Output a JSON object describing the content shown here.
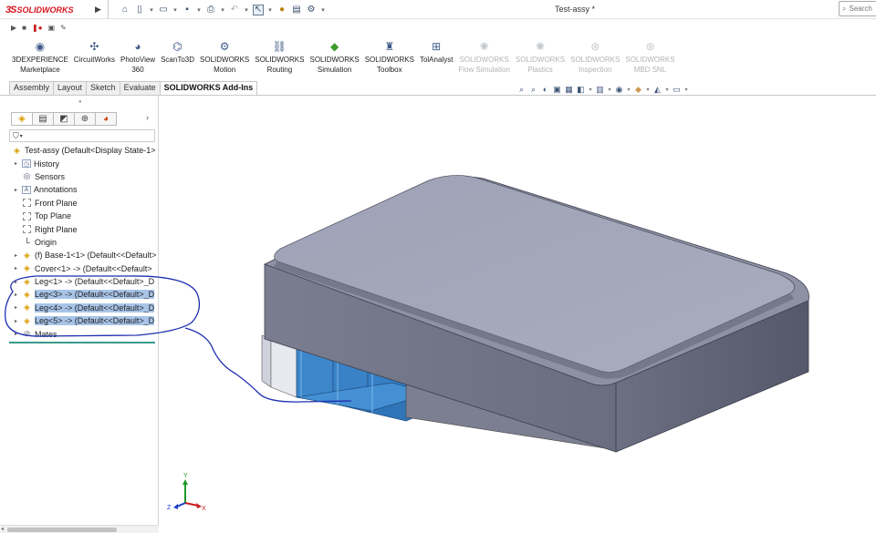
{
  "app": {
    "logo_ds": "3S",
    "logo_name": "SOLIDWORKS",
    "document_title": "Test-assy *",
    "search_placeholder": "Search"
  },
  "command_manager": [
    {
      "line1": "3DEXPERIENCE",
      "line2": "Marketplace",
      "icon": "globe-icon",
      "enabled": true
    },
    {
      "line1": "CircuitWorks",
      "line2": "",
      "icon": "circuit-icon",
      "enabled": true
    },
    {
      "line1": "PhotoView",
      "line2": "360",
      "icon": "sphere-icon",
      "enabled": true
    },
    {
      "line1": "ScanTo3D",
      "line2": "",
      "icon": "scan-icon",
      "enabled": true
    },
    {
      "line1": "SOLIDWORKS",
      "line2": "Motion",
      "icon": "motion-icon",
      "enabled": true
    },
    {
      "line1": "SOLIDWORKS",
      "line2": "Routing",
      "icon": "routing-icon",
      "enabled": true
    },
    {
      "line1": "SOLIDWORKS",
      "line2": "Simulation",
      "icon": "simulation-icon",
      "enabled": true
    },
    {
      "line1": "SOLIDWORKS",
      "line2": "Toolbox",
      "icon": "toolbox-icon",
      "enabled": true
    },
    {
      "line1": "TolAnalyst",
      "line2": "",
      "icon": "tolanalyst-icon",
      "enabled": true
    },
    {
      "line1": "SOLIDWORKS",
      "line2": "Flow Simulation",
      "icon": "flow-icon",
      "enabled": false
    },
    {
      "line1": "SOLIDWORKS",
      "line2": "Plastics",
      "icon": "plastics-icon",
      "enabled": false
    },
    {
      "line1": "SOLIDWORKS",
      "line2": "Inspection",
      "icon": "inspection-icon",
      "enabled": false
    },
    {
      "line1": "SOLIDWORKS",
      "line2": "MBD SNL",
      "icon": "mbd-icon",
      "enabled": false
    }
  ],
  "tabs": [
    {
      "label": "Assembly",
      "active": false
    },
    {
      "label": "Layout",
      "active": false
    },
    {
      "label": "Sketch",
      "active": false
    },
    {
      "label": "Evaluate",
      "active": false
    },
    {
      "label": "SOLIDWORKS Add-Ins",
      "active": true
    }
  ],
  "feature_tree": {
    "root": "Test-assy  (Default<Display State-1>",
    "items": [
      {
        "label": "History",
        "icon": "folder-icon",
        "expand": true,
        "selected": false
      },
      {
        "label": "Sensors",
        "icon": "sensor-icon",
        "expand": false,
        "selected": false
      },
      {
        "label": "Annotations",
        "icon": "annotation-icon",
        "expand": true,
        "selected": false
      },
      {
        "label": "Front Plane",
        "icon": "plane-icon",
        "expand": false,
        "selected": false
      },
      {
        "label": "Top Plane",
        "icon": "plane-icon",
        "expand": false,
        "selected": false
      },
      {
        "label": "Right Plane",
        "icon": "plane-icon",
        "expand": false,
        "selected": false
      },
      {
        "label": "Origin",
        "icon": "origin-icon",
        "expand": false,
        "selected": false
      },
      {
        "label": "(f) Base-1<1> (Default<<Default>",
        "icon": "part-icon",
        "expand": true,
        "selected": false
      },
      {
        "label": "Cover<1> -> (Default<<Default>",
        "icon": "part-icon",
        "expand": true,
        "selected": false
      },
      {
        "label": "Leg<1> -> (Default<<Default>_D",
        "icon": "part-icon",
        "expand": true,
        "selected": false
      },
      {
        "label": "Leg<3> -> (Default<<Default>_D",
        "icon": "part-icon",
        "expand": true,
        "selected": true
      },
      {
        "label": "Leg<4> -> (Default<<Default>_D",
        "icon": "part-icon",
        "expand": true,
        "selected": true
      },
      {
        "label": "Leg<5> -> (Default<<Default>_D",
        "icon": "part-icon",
        "expand": true,
        "selected": true
      },
      {
        "label": "Mates",
        "icon": "mates-icon",
        "expand": true,
        "selected": false
      }
    ]
  },
  "triad": {
    "x": "X",
    "y": "Y",
    "z": "Z"
  },
  "colors": {
    "selection_highlight": "#a8c4e8",
    "part_top": "#a2a5b8",
    "part_side": "#5c5f72",
    "selected_legs": "#3d86c9",
    "annotation_ink": "#1e2fb0"
  }
}
